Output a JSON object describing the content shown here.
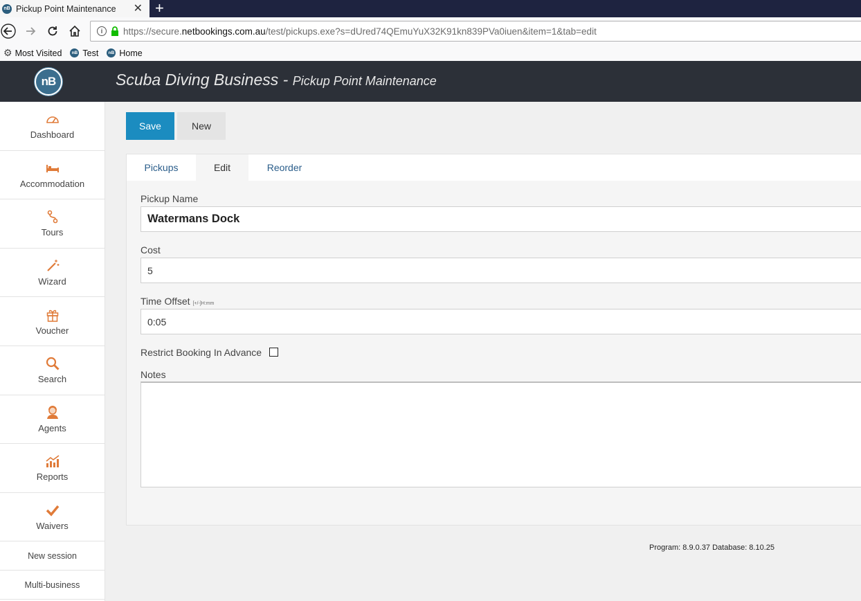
{
  "browser": {
    "tab_title": "Pickup Point Maintenance",
    "tab_close": "✕",
    "new_tab": "+",
    "favicon_text": "nB",
    "url_prefix": "https://secure.",
    "url_domain": "netbookings.com.au",
    "url_path": "/test/pickups.exe?s=dUred74QEmuYuX32K91kn839PVa0iuen&item=1&tab=edit",
    "bookmarks": [
      {
        "label": "Most Visited",
        "icon": "gear-icon"
      },
      {
        "label": "Test",
        "icon": "nb-favicon"
      },
      {
        "label": "Home",
        "icon": "nb-favicon"
      }
    ]
  },
  "header": {
    "logo_text": "nB",
    "business": "Scuba Diving Business",
    "separator": " - ",
    "page": "Pickup Point Maintenance"
  },
  "sidebar": {
    "items": [
      {
        "label": "Dashboard",
        "icon": "dashboard-icon"
      },
      {
        "label": "Accommodation",
        "icon": "bed-icon"
      },
      {
        "label": "Tours",
        "icon": "route-icon"
      },
      {
        "label": "Wizard",
        "icon": "wand-icon"
      },
      {
        "label": "Voucher",
        "icon": "gift-icon"
      },
      {
        "label": "Search",
        "icon": "search-icon"
      },
      {
        "label": "Agents",
        "icon": "agent-icon"
      },
      {
        "label": "Reports",
        "icon": "chart-icon"
      },
      {
        "label": "Waivers",
        "icon": "check-icon"
      }
    ],
    "plain_items": [
      "New session",
      "Multi-business"
    ]
  },
  "toolbar": {
    "save_label": "Save",
    "new_label": "New"
  },
  "tabs": [
    "Pickups",
    "Edit",
    "Reorder"
  ],
  "active_tab": "Edit",
  "form": {
    "pickup_name_label": "Pickup Name",
    "pickup_name_value": "Watermans Dock",
    "cost_label": "Cost",
    "cost_value": "5",
    "time_offset_label": "Time Offset",
    "time_offset_hint": "[+/-]H:mm",
    "time_offset_value": "0:05",
    "restrict_label": "Restrict Booking In Advance",
    "restrict_checked": false,
    "notes_label": "Notes",
    "notes_value": ""
  },
  "footer": {
    "version": "Program: 8.9.0.37 Database: 8.10.25"
  },
  "colors": {
    "accent": "#1b8cc0",
    "header_bg": "#2c3038",
    "icon_orange": "#e07b39",
    "tab_link": "#2a5d8a"
  }
}
